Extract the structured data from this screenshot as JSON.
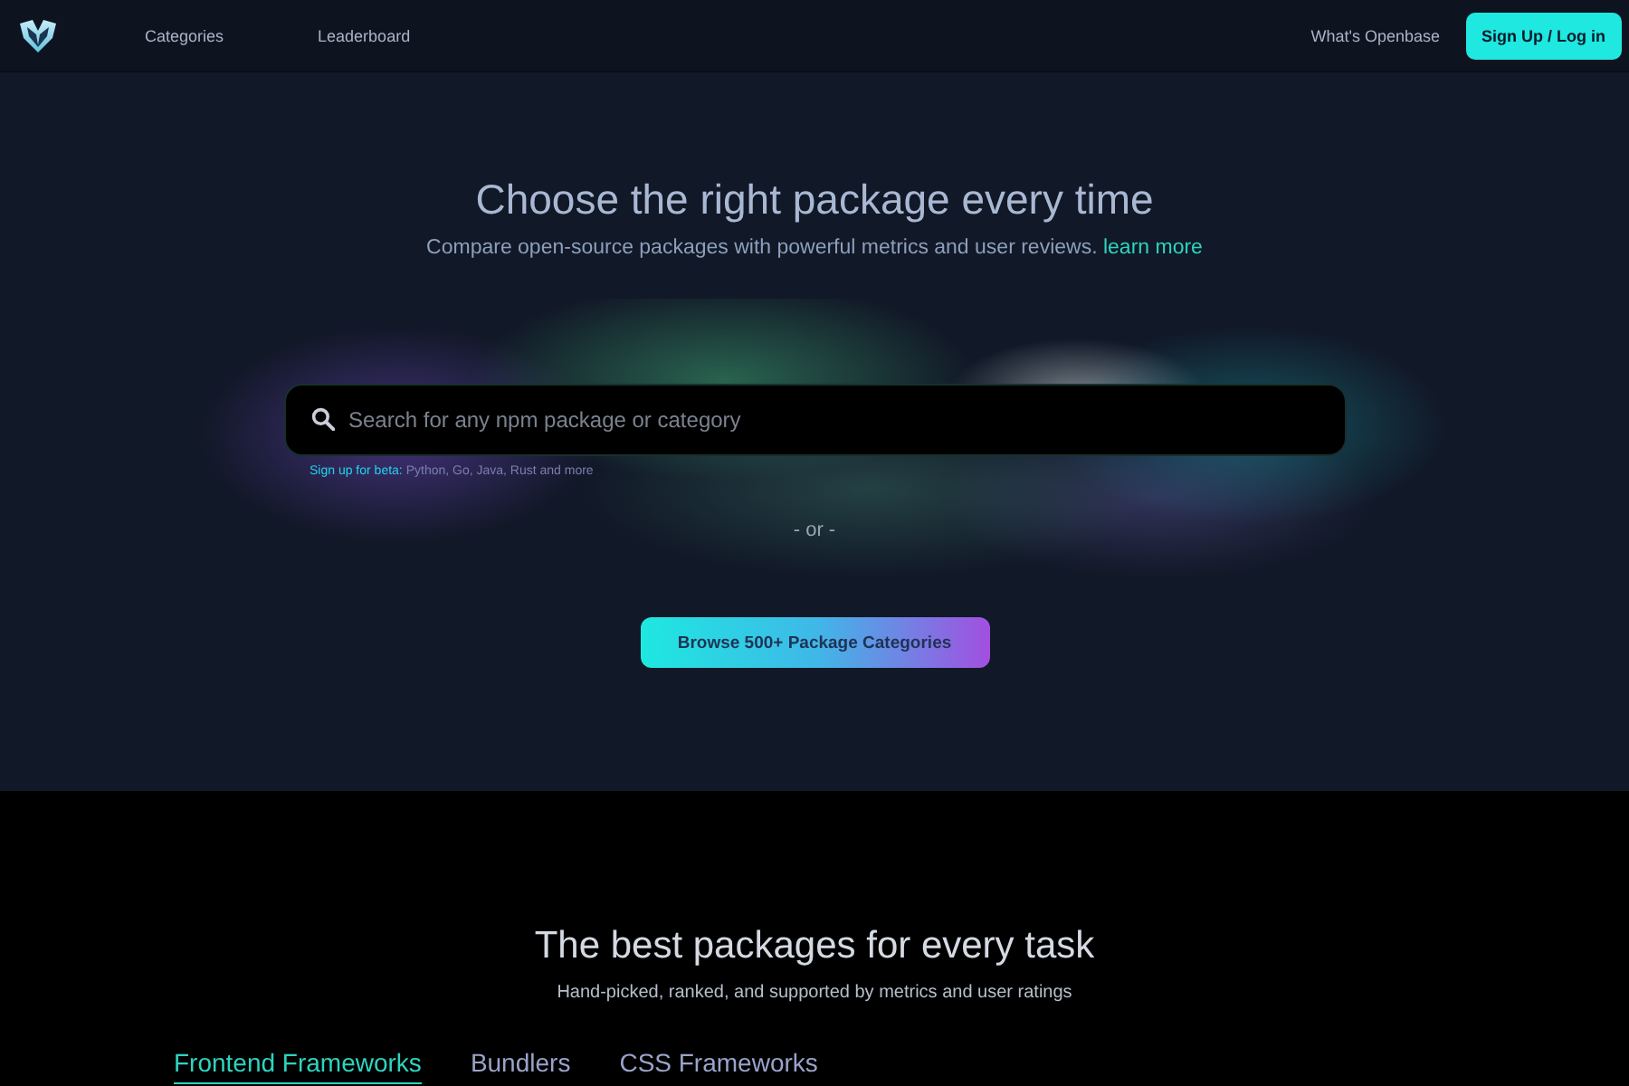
{
  "nav": {
    "links": [
      {
        "label": "Categories"
      },
      {
        "label": "Leaderboard"
      }
    ],
    "about_link": "What's Openbase",
    "signup_button": "Sign Up / Log in"
  },
  "hero": {
    "title": "Choose the right package every time",
    "subtitle": "Compare open-source packages with powerful metrics and user reviews.",
    "subtitle_link": "learn more",
    "search": {
      "placeholder": "Search for any npm package or category"
    },
    "beta_note": {
      "link": "Sign up for beta:",
      "text": "Python, Go, Java, Rust and more"
    },
    "separator": "- or -",
    "browse_button": "Browse 500+ Package Categories"
  },
  "featured": {
    "title": "The best packages for every task",
    "subtitle": "Hand-picked, ranked, and supported by metrics and user ratings",
    "tabs": [
      {
        "label": "Frontend Frameworks",
        "selected": true
      },
      {
        "label": "Bundlers",
        "selected": false
      },
      {
        "label": "CSS Frameworks",
        "selected": false
      }
    ]
  }
}
